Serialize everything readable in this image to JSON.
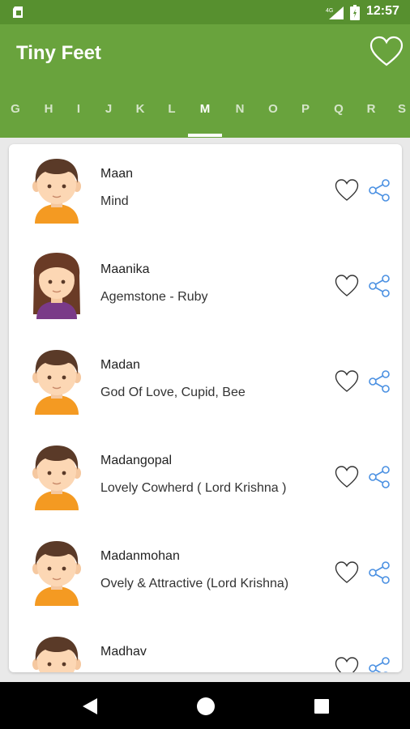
{
  "status_bar": {
    "network": "4G",
    "time": "12:57",
    "icons": [
      "sim-card-icon",
      "signal-icon",
      "battery-icon"
    ]
  },
  "app_bar": {
    "title": "Tiny Feet",
    "favorites_icon": "heart-outline-icon"
  },
  "tabs": {
    "items": [
      "G",
      "H",
      "I",
      "J",
      "K",
      "L",
      "M",
      "N",
      "O",
      "P",
      "Q",
      "R",
      "S"
    ],
    "selected": "M"
  },
  "names": [
    {
      "name": "Maan",
      "meaning": "Mind",
      "avatar": "boy-avatar"
    },
    {
      "name": "Maanika",
      "meaning": "Agemstone - Ruby",
      "avatar": "girl-avatar"
    },
    {
      "name": "Madan",
      "meaning": "God Of Love, Cupid, Bee",
      "avatar": "boy-avatar"
    },
    {
      "name": "Madangopal",
      "meaning": "Lovely Cowherd ( Lord Krishna )",
      "avatar": "boy-avatar"
    },
    {
      "name": "Madanmohan",
      "meaning": "Ovely & Attractive (Lord Krishna)",
      "avatar": "boy-avatar"
    },
    {
      "name": "Madhav",
      "meaning": "",
      "avatar": "boy-avatar"
    }
  ],
  "row_actions": {
    "favorite_icon": "heart-outline-icon",
    "share_icon": "share-icon"
  },
  "nav_bar": {
    "icons": [
      "back-icon",
      "home-icon",
      "recents-icon"
    ]
  },
  "colors": {
    "status_bar": "#57902f",
    "app_bar": "#69a33d",
    "share_icon": "#4a90e2",
    "background": "#e9e9e9"
  }
}
